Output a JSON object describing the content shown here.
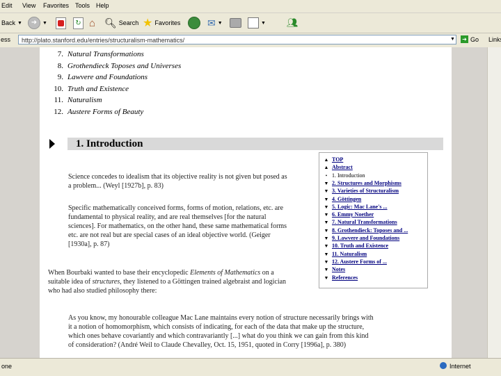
{
  "menubar": {
    "items": [
      "Edit",
      "View",
      "Favorites",
      "Tools",
      "Help"
    ]
  },
  "toolbar": {
    "back_label": "Back",
    "search_label": "Search",
    "favorites_label": "Favorites"
  },
  "addressbar": {
    "label": "ess",
    "url": "http://plato.stanford.edu/entries/structuralism-mathematics/",
    "go_label": "Go",
    "links_label": "Links"
  },
  "toc": [
    {
      "num": "7.",
      "text": "Natural Transformations"
    },
    {
      "num": "8.",
      "text": "Grothendieck Toposes and Universes"
    },
    {
      "num": "9.",
      "text": "Lawvere and Foundations"
    },
    {
      "num": "10.",
      "text": "Truth and Existence"
    },
    {
      "num": "11.",
      "text": "Naturalism"
    },
    {
      "num": "12.",
      "text": "Austere Forms of Beauty"
    }
  ],
  "section": {
    "title": "1. Introduction"
  },
  "paragraphs": {
    "p1": [
      "Science concedes to idealism that its objective reality is not given but posed as",
      "a problem... (Weyl [1927b], p. 83)"
    ],
    "p2": [
      "Specific mathematically conceived forms, forms of motion, relations, etc. are",
      "fundamental to physical reality, and are real themselves [for the natural",
      "sciences]. For mathematics, on the other hand, these same mathematical forms",
      "etc. are not real but are special cases of an ideal objective world. (Geiger",
      "[1930a], p. 87)"
    ],
    "p3": [
      "When Bourbaki wanted to base their encyclopedic ",
      "Elements of Mathematics",
      " on a",
      "suitable idea of ",
      "structures",
      ", they listened to a Göttingen trained algebraist and logician",
      "who had also studied philosophy there:"
    ],
    "p4": [
      "As you know, my honourable colleague Mac Lane maintains every notion of structure necessarily brings with",
      "it a notion of homomorphism, which consists of indicating, for each of the data that make up the structure,",
      "which ones behave covariantly and which contravariantly [...] what do you think we can gain from this kind",
      "of consideration? (André Weil to Claude Chevalley, Oct. 15, 1951, quoted in Corry [1996a], p. 380)"
    ]
  },
  "navbox": {
    "items": [
      {
        "label": "TOP",
        "arrow": "up"
      },
      {
        "label": "Abstract",
        "arrow": "up"
      },
      {
        "label": "1. Introduction",
        "arrow": "current"
      },
      {
        "label": "2. Structures and Morphisms",
        "arrow": "down"
      },
      {
        "label": "3. Varieties of Structuralism",
        "arrow": "down"
      },
      {
        "label": "4. Göttingen",
        "arrow": "down"
      },
      {
        "label": "5. Logic: Mac Lane's ...",
        "arrow": "down"
      },
      {
        "label": "6. Emmy Noether",
        "arrow": "down"
      },
      {
        "label": "7. Natural Transformations",
        "arrow": "down"
      },
      {
        "label": "8. Grothendieck: Toposes and ...",
        "arrow": "down"
      },
      {
        "label": "9. Lawvere and Foundations",
        "arrow": "down"
      },
      {
        "label": "10. Truth and Existence",
        "arrow": "down"
      },
      {
        "label": "11. Naturalism",
        "arrow": "down"
      },
      {
        "label": "12. Austere Forms of ...",
        "arrow": "down"
      },
      {
        "label": "Notes",
        "arrow": "down"
      },
      {
        "label": "References",
        "arrow": "down"
      }
    ]
  },
  "statusbar": {
    "left": "one",
    "zone": "Internet"
  },
  "colors": {
    "link": "#00007f",
    "heading_bg": "#d9d9d9",
    "chrome": "#ece9d8"
  }
}
